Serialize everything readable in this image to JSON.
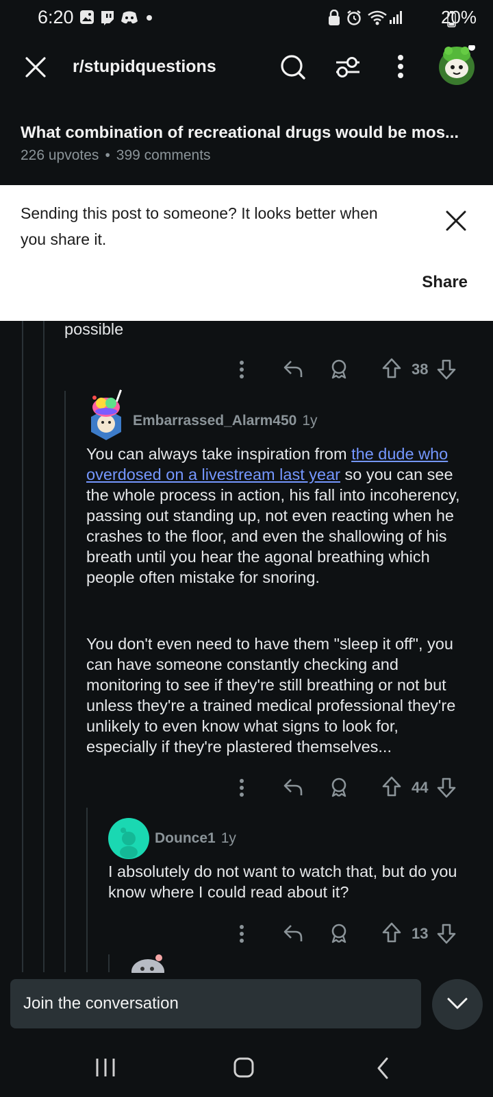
{
  "status_bar": {
    "time": "6:20",
    "battery": "20%"
  },
  "header": {
    "subreddit": "r/stupidquestions"
  },
  "post": {
    "title": "What combination of recreational drugs would be mos...",
    "upvotes": "226 upvotes",
    "comments": "399 comments"
  },
  "share_banner": {
    "message": "Sending this post to someone? It looks better when you share it.",
    "share_label": "Share"
  },
  "comments": [
    {
      "text_fragment": "possible",
      "votes": "38"
    },
    {
      "username": "Embarrassed_Alarm450",
      "age": "1y",
      "text_before_link": "You can always take inspiration from ",
      "link_text": "the dude who overdosed on a livestream last year",
      "text_after_link": " so you can see the whole process in action, his fall into incoherency, passing out standing up, not even reacting when he crashes to the floor, and even the shallowing of his breath until you hear the agonal breathing which people often mistake for snoring.",
      "paragraph2": "You don't even need to have them \"sleep it off\", you can have someone constantly checking and monitoring to see if they're still breathing or not but unless they're a trained medical professional they're unlikely to even know what signs to look for, especially if they're plastered themselves...",
      "votes": "44"
    },
    {
      "username": "Dounce1",
      "age": "1y",
      "text": "I absolutely do not want to watch that, but do you know where I could read about it?",
      "votes": "13"
    }
  ],
  "composer": {
    "placeholder": "Join the conversation"
  },
  "colors": {
    "background": "#0e1113",
    "link": "#7597ff",
    "avatar_teal": "#1ad8b2",
    "muted": "#8b9499"
  },
  "icons": [
    "close-icon",
    "search-icon",
    "filter-icon",
    "more-icon",
    "reply-icon",
    "award-icon",
    "upvote-icon",
    "downvote-icon",
    "chevron-down-icon"
  ]
}
